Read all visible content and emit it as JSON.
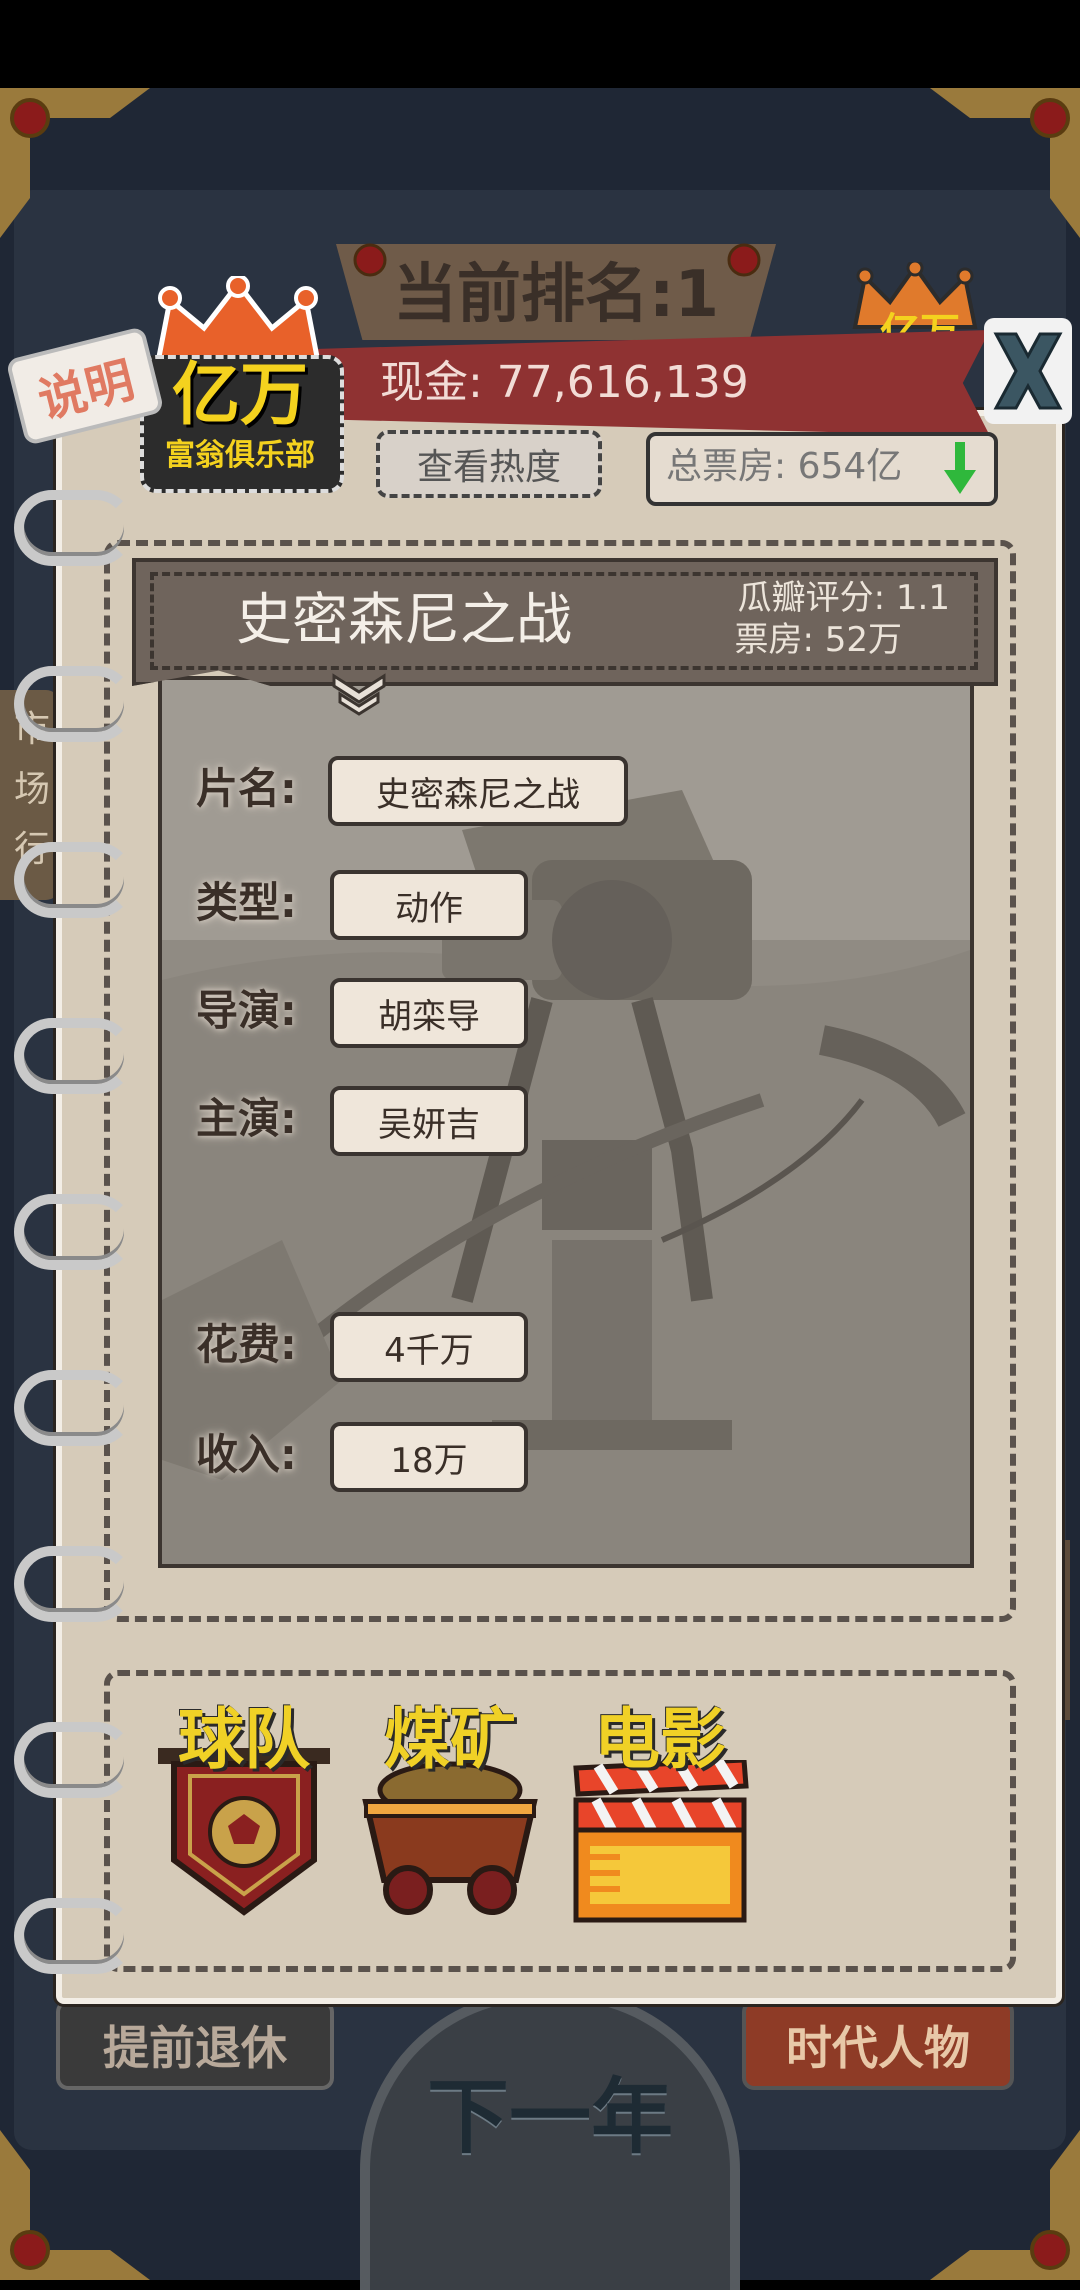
{
  "header": {
    "rank_text": "当前排名:1",
    "cash_text": "现金: 77,616,139",
    "heat_button": "查看热度",
    "box_office_total": "总票房: 654亿",
    "explain_button": "说明",
    "logo_main": "亿万",
    "logo_sub": "富翁俱乐部",
    "crown_right_text": "亿万"
  },
  "side_board_text": [
    "市",
    "场",
    "行"
  ],
  "movie": {
    "title": "史密森尼之战",
    "rating": "瓜瓣评分: 1.1",
    "box_office": "票房: 52万",
    "details": {
      "name_label": "片名:",
      "name_value": "史密森尼之战",
      "genre_label": "类型:",
      "genre_value": "动作",
      "director_label": "导演:",
      "director_value": "胡栾导",
      "lead_label": "主演:",
      "lead_value": "吴妍吉",
      "cost_label": "花费:",
      "cost_value": "4千万",
      "income_label": "收入:",
      "income_value": "18万"
    }
  },
  "businesses": [
    {
      "label": "球队",
      "icon": "soccer-team-pennant"
    },
    {
      "label": "煤矿",
      "icon": "coal-mine-cart"
    },
    {
      "label": "电影",
      "icon": "film-clapperboard"
    }
  ],
  "bottom": {
    "retire_button": "提前退休",
    "next_year_button": "下一年",
    "people_button": "时代人物"
  },
  "colors": {
    "cash_banner": "#8f3232",
    "accent_yellow": "#f0d126",
    "paper": "#d6cbb9",
    "frame": "#1f2735"
  }
}
